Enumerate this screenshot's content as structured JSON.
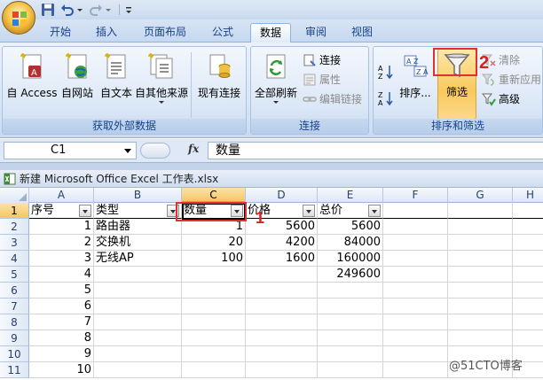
{
  "tabs": [
    {
      "label": "开始"
    },
    {
      "label": "插入"
    },
    {
      "label": "页面布局"
    },
    {
      "label": "公式"
    },
    {
      "label": "数据",
      "active": true
    },
    {
      "label": "审阅"
    },
    {
      "label": "视图"
    }
  ],
  "ribbon": {
    "external_data": {
      "group_label": "获取外部数据",
      "from_access": "自 Access",
      "from_web": "自网站",
      "from_text": "自文本",
      "from_other": "自其他来源",
      "existing_connections": "现有连接"
    },
    "connections": {
      "group_label": "连接",
      "refresh_all": "全部刷新",
      "connections": "连接",
      "properties": "属性",
      "edit_links": "编辑链接"
    },
    "sort_filter": {
      "group_label": "排序和筛选",
      "sort": "排序...",
      "filter": "筛选",
      "clear": "清除",
      "reapply": "重新应用",
      "advanced": "高级",
      "sort_az": "A Z",
      "sort_za": "Z A"
    }
  },
  "formula_bar": {
    "name_box": "C1",
    "fx_label": "fx",
    "content": "数量"
  },
  "workbook": {
    "title": "新建 Microsoft Office Excel 工作表.xlsx"
  },
  "grid": {
    "columns": [
      "A",
      "B",
      "C",
      "D",
      "E",
      "F",
      "G",
      "H"
    ],
    "rows": [
      "1",
      "2",
      "3",
      "4",
      "5",
      "6",
      "7",
      "8",
      "9",
      "10",
      "11"
    ],
    "headers": [
      "序号",
      "类型",
      "数量",
      "价格",
      "总价"
    ],
    "data": [
      {
        "seq": "1",
        "type": "路由器",
        "qty": "1",
        "price": "5600",
        "total": "5600"
      },
      {
        "seq": "2",
        "type": "交换机",
        "qty": "20",
        "price": "4200",
        "total": "84000"
      },
      {
        "seq": "3",
        "type": "无线AP",
        "qty": "100",
        "price": "1600",
        "total": "160000"
      },
      {
        "seq": "4",
        "type": "",
        "qty": "",
        "price": "",
        "total": "249600"
      },
      {
        "seq": "5",
        "type": "",
        "qty": "",
        "price": "",
        "total": ""
      },
      {
        "seq": "6",
        "type": "",
        "qty": "",
        "price": "",
        "total": ""
      },
      {
        "seq": "7",
        "type": "",
        "qty": "",
        "price": "",
        "total": ""
      },
      {
        "seq": "8",
        "type": "",
        "qty": "",
        "price": "",
        "total": ""
      },
      {
        "seq": "9",
        "type": "",
        "qty": "",
        "price": "",
        "total": ""
      },
      {
        "seq": "10",
        "type": "",
        "qty": "",
        "price": "",
        "total": ""
      }
    ]
  },
  "annotations": {
    "step1": "1",
    "step2": "2"
  },
  "watermark": "@51CTO博客",
  "colors": {
    "accent": "#15428b",
    "annotation": "#e03030",
    "selection": "#f6c567"
  }
}
